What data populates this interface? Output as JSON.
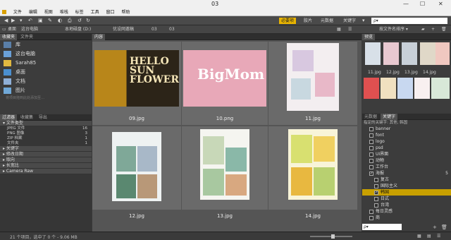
{
  "window": {
    "title": "03",
    "controls": [
      "—",
      "☐",
      "✕"
    ]
  },
  "menu": [
    "文件",
    "编辑",
    "视图",
    "堆栈",
    "标签",
    "工具",
    "窗口",
    "帮助"
  ],
  "toolbar": {
    "workspaces": [
      "必要项",
      "胶片",
      "元数据",
      "关键字"
    ],
    "active_workspace": "必要项",
    "search_placeholder": "ρ▾"
  },
  "path": {
    "crumbs": [
      "桌面",
      "这台电脑",
      "本地磁盘 (D:)",
      "优设网邀稿",
      "03",
      "03"
    ]
  },
  "left": {
    "tabs": [
      "收藏夹",
      "文件夹"
    ],
    "favorites": [
      {
        "label": "库",
        "icon": "library-icon"
      },
      {
        "label": "这台电脑",
        "icon": "computer-icon"
      },
      {
        "label": "Sarah85",
        "icon": "user-folder-icon"
      },
      {
        "label": "桌面",
        "icon": "desktop-icon"
      },
      {
        "label": "文档",
        "icon": "documents-icon"
      },
      {
        "label": "图片",
        "icon": "pictures-icon"
      }
    ],
    "drag_hint": "将项目拖到此处添加至…",
    "filter_tabs": [
      "过滤器",
      "收藏集",
      "导出"
    ],
    "filter_groups": [
      {
        "title": "文件类型",
        "rows": [
          {
            "label": "JPEG 文件",
            "count": "16"
          },
          {
            "label": "PNG 图像",
            "count": "3"
          },
          {
            "label": "ZIP 档案",
            "count": "1"
          },
          {
            "label": "文件夹",
            "count": "1"
          }
        ]
      },
      {
        "title": "关键字",
        "rows": []
      },
      {
        "title": "修改日期",
        "rows": []
      },
      {
        "title": "取向",
        "rows": []
      },
      {
        "title": "长宽比",
        "rows": []
      },
      {
        "title": "Camera Raw",
        "rows": []
      }
    ]
  },
  "content": {
    "tab": "内容",
    "thumbnails": [
      {
        "label": "09.jpg",
        "art": "HELLO SUN FLOWER",
        "kind": "sunflower"
      },
      {
        "label": "10.png",
        "art": "BigMom",
        "kind": "pink"
      },
      {
        "label": "11.jpg",
        "art": "",
        "kind": "poster"
      },
      {
        "label": "12.jpg",
        "art": "",
        "kind": "poster-green"
      },
      {
        "label": "13.jpg",
        "art": "",
        "kind": "poster-white"
      },
      {
        "label": "14.jpg",
        "art": "",
        "kind": "poster-yellow"
      }
    ]
  },
  "right": {
    "preview_tab": "预览",
    "preview_labels": [
      "11.jpg",
      "12.jpg",
      "13.jpg",
      "14.jpg"
    ],
    "meta_tabs": [
      "元数据",
      "关键字"
    ],
    "keyword_sub": [
      "指定的关键字",
      "其他",
      "韩国"
    ],
    "keywords": [
      {
        "label": "banner",
        "checked": false,
        "indent": 0
      },
      {
        "label": "font",
        "checked": false,
        "indent": 0
      },
      {
        "label": "logo",
        "checked": false,
        "indent": 0
      },
      {
        "label": "psd",
        "checked": false,
        "indent": 0
      },
      {
        "label": "UI界面",
        "checked": false,
        "indent": 0
      },
      {
        "label": "动物",
        "checked": false,
        "indent": 0
      },
      {
        "label": "工作台",
        "checked": false,
        "indent": 0
      },
      {
        "label": "海报",
        "checked": true,
        "indent": 0
      },
      {
        "label": "复古",
        "checked": false,
        "indent": 1
      },
      {
        "label": "国际主义",
        "checked": false,
        "indent": 1
      },
      {
        "label": "韩国",
        "checked": true,
        "indent": 1,
        "selected": true
      },
      {
        "label": "日式",
        "checked": false,
        "indent": 1
      },
      {
        "label": "台湾",
        "checked": false,
        "indent": 1
      },
      {
        "label": "每日灵感",
        "checked": false,
        "indent": 0
      },
      {
        "label": "商",
        "checked": false,
        "indent": 0
      }
    ],
    "keyword_count": "5",
    "search_placeholder": "ρ▾"
  },
  "status": {
    "text": "21 个项目，选中了 0 个 - 9.06 MB"
  },
  "colors": {
    "accent": "#e8b400",
    "panel": "#3c3c3c",
    "content": "#5a5a5a"
  }
}
